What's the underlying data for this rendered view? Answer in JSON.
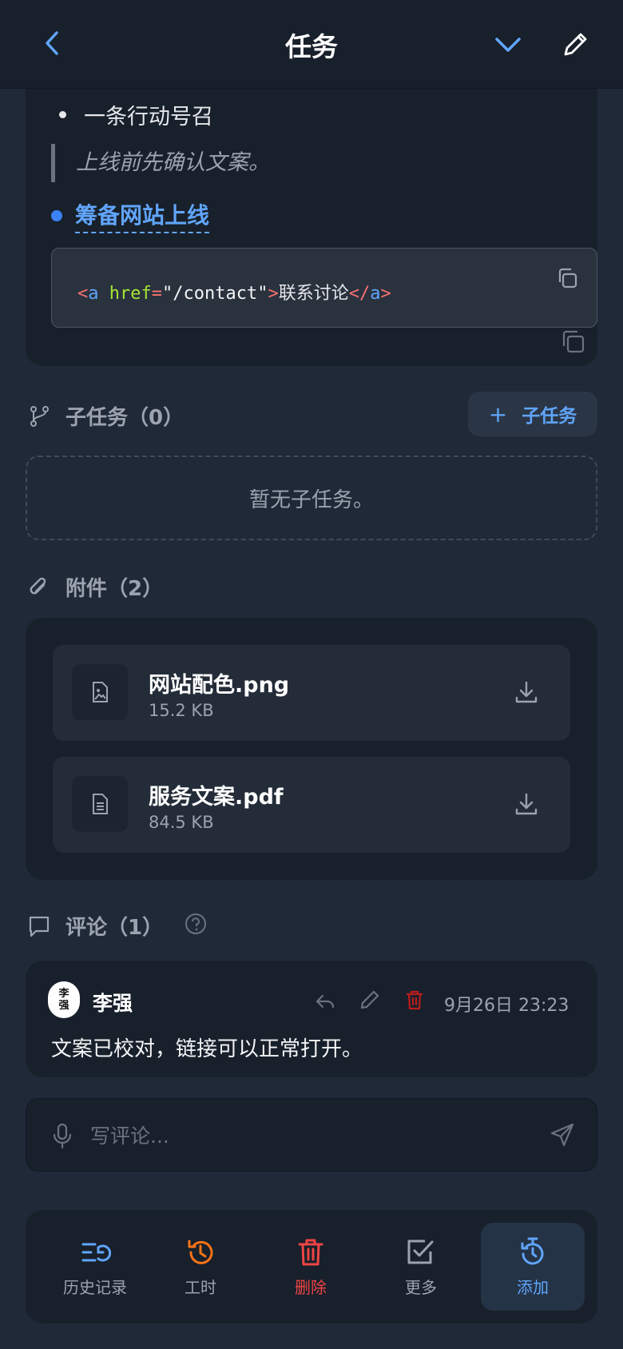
{
  "header": {
    "title": "任务",
    "icons": {
      "back": "chevron-left-icon",
      "collapse": "chevron-down-icon",
      "edit": "pencil-icon"
    }
  },
  "description": {
    "bullet": "一条行动号召",
    "quote": "上线前先确认文案。",
    "task_link": "筹备网站上线",
    "code": {
      "open_lt": "<",
      "tag": "a",
      "attr": "href",
      "eq": "=",
      "value": "\"/contact\"",
      "close_gt": ">",
      "text": "联系讨论",
      "end_open": "</",
      "end_tag": "a",
      "end_gt": ">"
    }
  },
  "subtasks": {
    "title": "子任务（0）",
    "add_label": "子任务",
    "empty_text": "暂无子任务。"
  },
  "attachments": {
    "title": "附件（2）",
    "items": [
      {
        "name": "网站配色.png",
        "size": "15.2 KB",
        "icon": "image-file-icon"
      },
      {
        "name": "服务文案.pdf",
        "size": "84.5 KB",
        "icon": "document-file-icon"
      }
    ]
  },
  "comments": {
    "title": "评论（1）",
    "items": [
      {
        "avatar_line1": "李",
        "avatar_line2": "强",
        "author": "李强",
        "time": "9月26日 23:23",
        "text": "文案已校对，链接可以正常打开。"
      }
    ],
    "input_placeholder": "写评论..."
  },
  "bottom_bar": {
    "items": [
      {
        "label": "历史记录",
        "color": "#9ca3af",
        "icon": "history-list-icon"
      },
      {
        "label": "工时",
        "color": "#f97316",
        "icon": "clock-history-icon"
      },
      {
        "label": "删除",
        "color": "#ef4444",
        "icon": "trash-icon"
      },
      {
        "label": "更多",
        "color": "#9ca3af",
        "icon": "checkbox-icon"
      },
      {
        "label": "添加",
        "color": "#60a5fa",
        "icon": "timer-icon"
      }
    ]
  },
  "colors": {
    "background": "#1f2937",
    "card": "#18202b",
    "accent": "#60a5fa",
    "danger": "#ef4444",
    "warning": "#f97316"
  }
}
